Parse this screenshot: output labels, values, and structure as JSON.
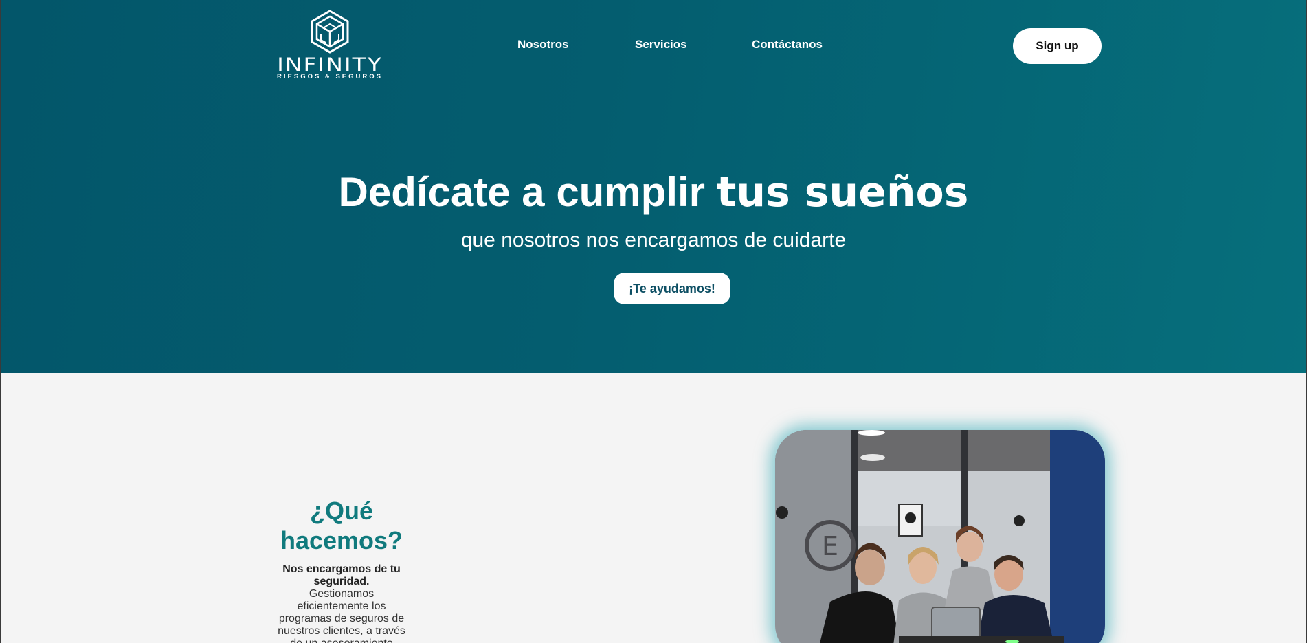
{
  "brand": {
    "name": "INFINITY",
    "tagline": "RIESGOS & SEGUROS",
    "logo_icon": "hexagon-cube-logo-icon"
  },
  "nav": {
    "items": [
      {
        "label": "Nosotros"
      },
      {
        "label": "Servicios"
      },
      {
        "label": "Contáctanos"
      }
    ],
    "signup_label": "Sign up"
  },
  "hero": {
    "title_regular": "Dedícate a cumplir ",
    "title_emphasis": "tus sueños",
    "subtitle": "que nosotros nos encargamos de cuidarte",
    "cta_label": "¡Te ayudamos!"
  },
  "about": {
    "heading": "¿Qué hacemos?",
    "lead": "Nos encargamos de tu seguridad.",
    "body": "Gestionamos eficientemente los programas de seguros de nuestros clientes, a través de un asesoramiento"
  },
  "photo": {
    "description_icon": "team-meeting-photo"
  },
  "colors": {
    "hero_start": "#03566a",
    "hero_end": "#066f7c",
    "accent_heading": "#107a7d",
    "cta_text": "#0c4e63",
    "page_bg": "#f4f4f4"
  }
}
